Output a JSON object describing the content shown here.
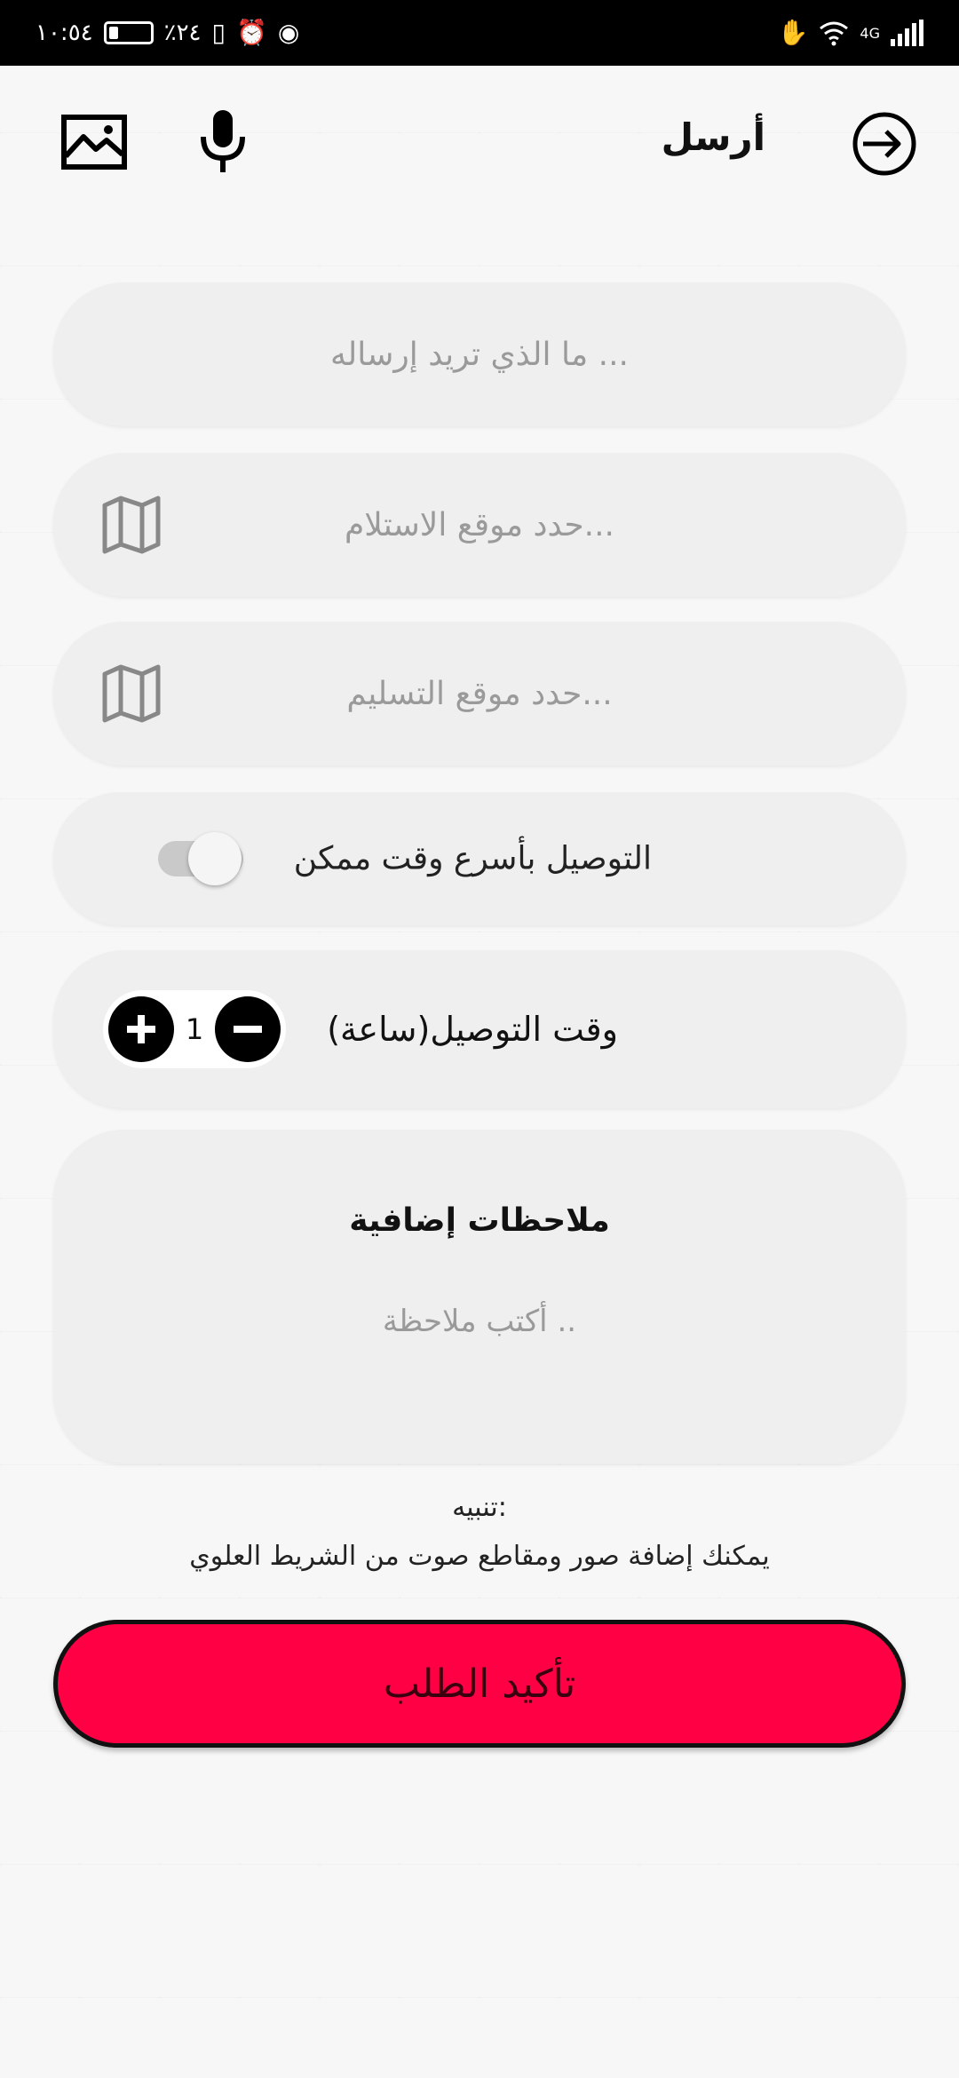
{
  "status_bar": {
    "time": "١٠:٥٤",
    "battery_percent": "٪٢٤",
    "battery_level": 0.24,
    "network": "4G"
  },
  "top_bar": {
    "send_label": "أرسل",
    "icons": [
      "image-icon",
      "microphone-icon",
      "sign-in-icon"
    ]
  },
  "form": {
    "what_placeholder": "ما الذي تريد إرساله ...",
    "pickup_placeholder": "حدد موقع الاستلام...",
    "delivery_placeholder": "حدد موقع التسليم...",
    "fast_delivery_label": "التوصيل بأسرع وقت ممكن",
    "fast_delivery_enabled": false,
    "delivery_time_label": "وقت التوصيل(ساعة)",
    "delivery_time_value": "1",
    "notes_title": "ملاحظات إضافية",
    "notes_placeholder": "أكتب ملاحظة .."
  },
  "notice": {
    "title": "تنبيه:",
    "text": "يمكنك إضافة صور ومقاطع صوت من الشريط العلوي"
  },
  "confirm_label": "تأكيد الطلب",
  "colors": {
    "accent": "#ff0044",
    "field_bg": "#efefef",
    "status_bar": "#000000"
  }
}
